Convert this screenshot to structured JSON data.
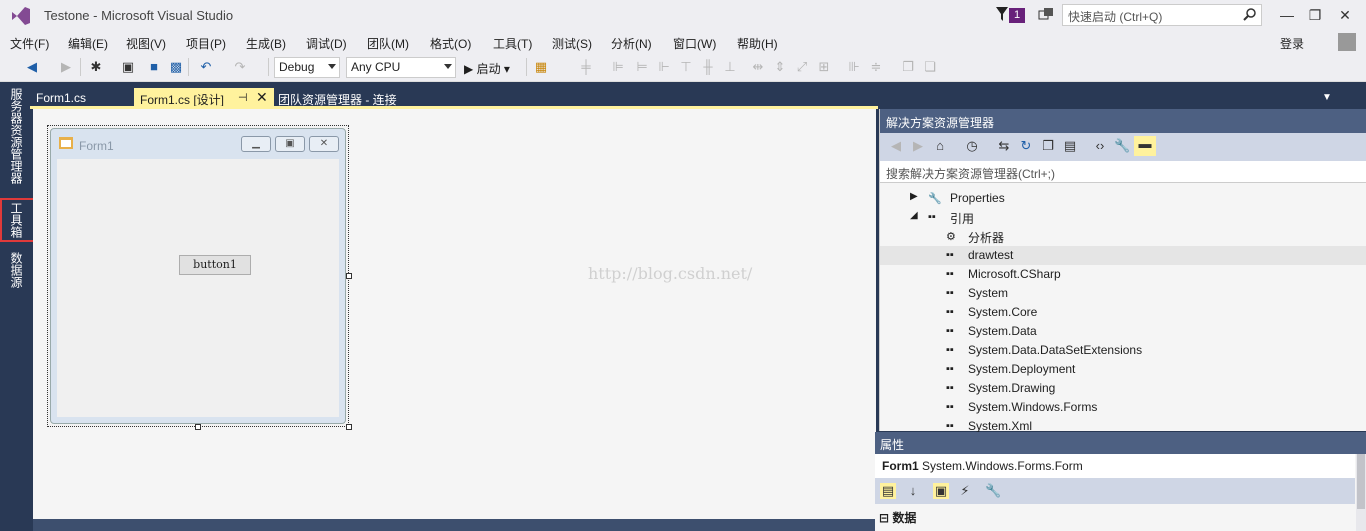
{
  "window": {
    "title": "Testone - Microsoft Visual Studio",
    "notification_count": "1",
    "quick_launch_placeholder": "快速启动 (Ctrl+Q)",
    "controls": {
      "minimize": "—",
      "restore": "❐",
      "close": "✕"
    }
  },
  "menu": {
    "items": [
      "文件(F)",
      "编辑(E)",
      "视图(V)",
      "项目(P)",
      "生成(B)",
      "调试(D)",
      "团队(M)",
      "格式(O)",
      "工具(T)",
      "测试(S)",
      "分析(N)",
      "窗口(W)",
      "帮助(H)"
    ],
    "login": "登录"
  },
  "toolbar": {
    "config": "Debug",
    "platform": "Any CPU",
    "start": "启动"
  },
  "left_strip": {
    "items": [
      "服务器资源管理器",
      "工具箱",
      "数据源"
    ]
  },
  "tabs": [
    {
      "label": "Form1.cs",
      "active": false
    },
    {
      "label": "Form1.cs [设计]",
      "active": true
    },
    {
      "label": "团队资源管理器 - 连接",
      "active": false
    }
  ],
  "tab_icons": {
    "pin": "⊣",
    "close": "✕"
  },
  "designer": {
    "form_title": "Form1",
    "button_text": "button1",
    "watermark": "http://blog.csdn.net/"
  },
  "solution_explorer": {
    "title": "解决方案资源管理器",
    "search_placeholder": "搜索解决方案资源管理器(Ctrl+;)",
    "tree": [
      {
        "label": "Properties",
        "depth": 0,
        "arrow": "▶",
        "icon": "wrench-icon"
      },
      {
        "label": "引用",
        "depth": 0,
        "arrow": "◢",
        "icon": "reference-icon"
      },
      {
        "label": "分析器",
        "depth": 1,
        "icon": "analyzer-icon"
      },
      {
        "label": "drawtest",
        "depth": 1,
        "icon": "reference-icon",
        "selected": true
      },
      {
        "label": "Microsoft.CSharp",
        "depth": 1,
        "icon": "reference-icon"
      },
      {
        "label": "System",
        "depth": 1,
        "icon": "reference-icon"
      },
      {
        "label": "System.Core",
        "depth": 1,
        "icon": "reference-icon"
      },
      {
        "label": "System.Data",
        "depth": 1,
        "icon": "reference-icon"
      },
      {
        "label": "System.Data.DataSetExtensions",
        "depth": 1,
        "icon": "reference-icon"
      },
      {
        "label": "System.Deployment",
        "depth": 1,
        "icon": "reference-icon"
      },
      {
        "label": "System.Drawing",
        "depth": 1,
        "icon": "reference-icon"
      },
      {
        "label": "System.Windows.Forms",
        "depth": 1,
        "icon": "reference-icon"
      },
      {
        "label": "System.Xml",
        "depth": 1,
        "icon": "reference-icon"
      }
    ]
  },
  "properties": {
    "title": "属性",
    "object_name": "Form1",
    "object_type": "System.Windows.Forms.Form",
    "category": "数据",
    "category_toggle": "⊟"
  },
  "colors": {
    "accent_tab": "#fff29d",
    "panel_header": "#4d6082",
    "chrome": "#eeeef2",
    "background": "#293955",
    "highlight": "#e03a3a"
  }
}
